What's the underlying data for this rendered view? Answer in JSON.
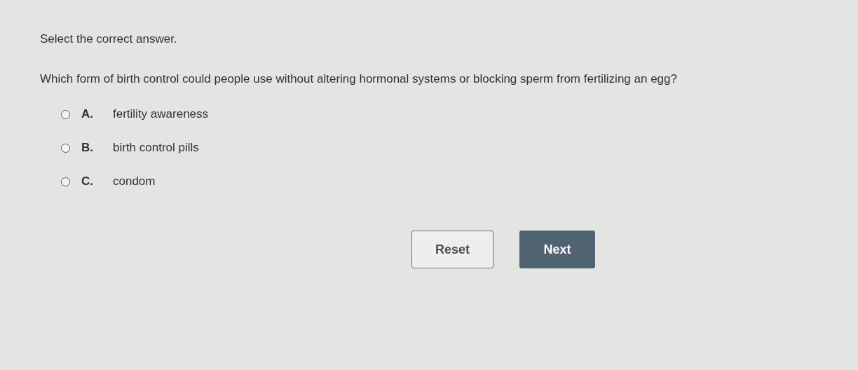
{
  "instruction": "Select the correct answer.",
  "question": "Which form of birth control could people use without altering hormonal systems or blocking sperm from fertilizing an egg?",
  "options": [
    {
      "letter": "A.",
      "text": "fertility awareness",
      "selected": false
    },
    {
      "letter": "B.",
      "text": "birth control pills",
      "selected": false
    },
    {
      "letter": "C.",
      "text": "condom",
      "selected": false
    }
  ],
  "buttons": [
    {
      "label": "Reset",
      "kind": "secondary"
    },
    {
      "label": "Next",
      "kind": "primary"
    }
  ]
}
